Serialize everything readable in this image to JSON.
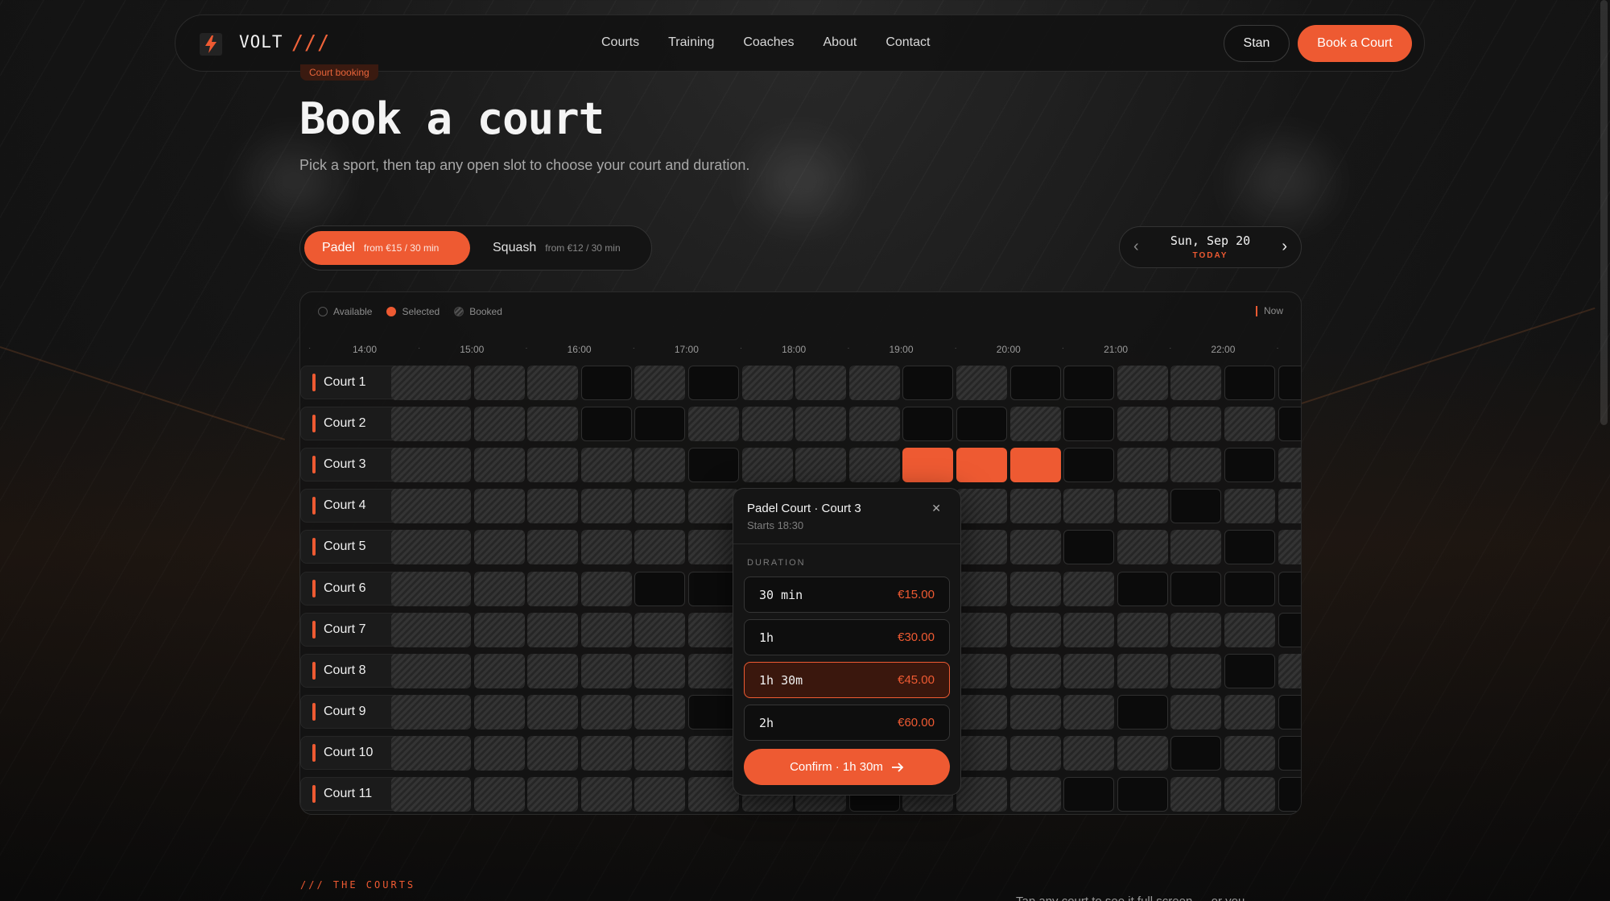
{
  "brand": {
    "name": "VOLT",
    "slashes": "///",
    "logo_icon": "lightning-icon",
    "accent": "#ee5a32"
  },
  "nav": {
    "links": [
      "Courts",
      "Training",
      "Coaches",
      "About",
      "Contact"
    ],
    "user_label": "Stan",
    "cta_label": "Book a Court"
  },
  "hero": {
    "badge": "Court booking",
    "title": "Book a court",
    "subtitle": "Pick a sport, then tap any open slot to choose your court and duration."
  },
  "sports": [
    {
      "name": "Padel",
      "price": "from €15 / 30 min",
      "active": true
    },
    {
      "name": "Squash",
      "price": "from €12 / 30 min",
      "active": false
    }
  ],
  "date": {
    "label": "Sun, Sep 20",
    "sub": "TODAY",
    "prev_icon": "chevron-left-icon",
    "next_icon": "chevron-right-icon"
  },
  "legend": {
    "available": "Available",
    "selected": "Selected",
    "booked": "Booked",
    "now": "Now"
  },
  "times": [
    "14:00",
    "15:00",
    "16:00",
    "17:00",
    "18:00",
    "19:00",
    "20:00",
    "21:00",
    "22:00"
  ],
  "courts": [
    "Court 1",
    "Court 2",
    "Court 3",
    "Court 4",
    "Court 5",
    "Court 6",
    "Court 7",
    "Court 8",
    "Court 9",
    "Court 10",
    "Court 11"
  ],
  "grid_status": [
    "bbbAbAbbbAbAAbbAA",
    "bbbAAbbbbAAbAbbbA",
    "bbbbbAbbbSSSAbbAb",
    "bbbbbbbbbbbbbbAbb",
    "bbbbbbbbbbbbAbbAb",
    "bbbbAAbbbbbbbAAAA",
    "bbbbbbbbbbbbbbbbA",
    "bbbbbbAbbbbbbbbAb",
    "bbbbbAbbbbbbbAbbA",
    "bbbbbbbbbbbbbbAbA",
    "bbbbbbbbAbbbAAbbA"
  ],
  "popover": {
    "title": "Padel Court · Court 3",
    "starts": "Starts 18:30",
    "duration_label": "DURATION",
    "options": [
      {
        "duration": "30 min",
        "price": "€15.00"
      },
      {
        "duration": "1h",
        "price": "€30.00"
      },
      {
        "duration": "1h 30m",
        "price": "€45.00"
      },
      {
        "duration": "2h",
        "price": "€60.00"
      }
    ],
    "selected_index": 2,
    "confirm_label": "Confirm · 1h 30m",
    "confirm_icon": "arrow-right-icon",
    "close_icon": "close-icon"
  },
  "footer_section": {
    "tag": "/// THE COURTS",
    "hint": "Tap any court to see it full screen — or you"
  }
}
